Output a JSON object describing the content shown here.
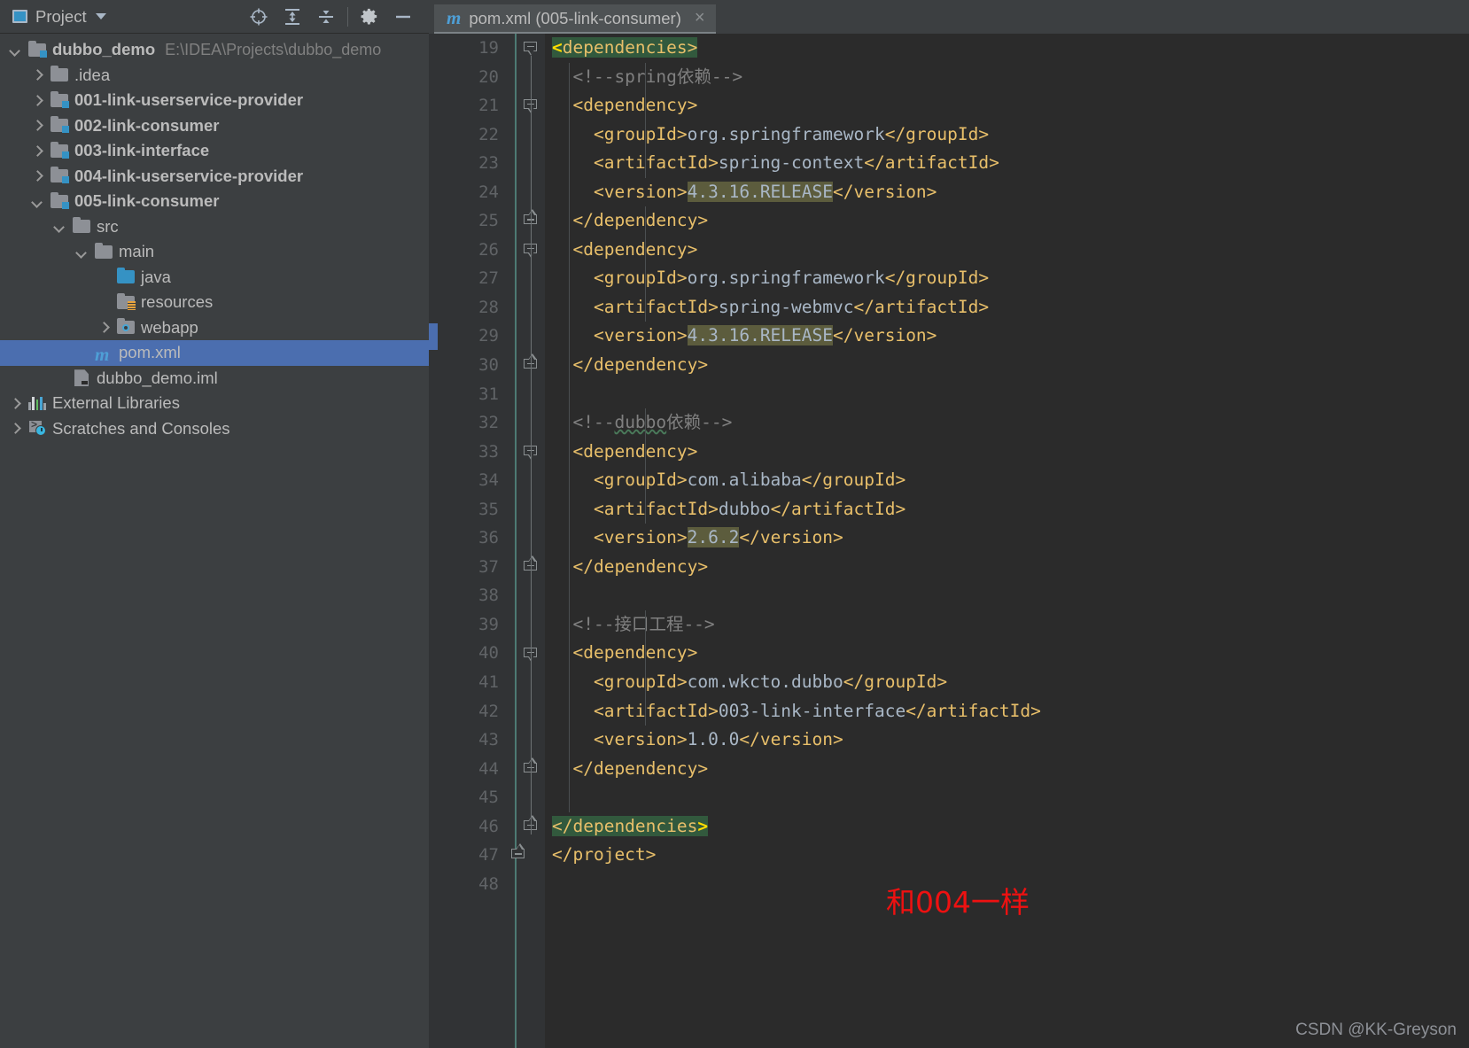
{
  "tool_window": {
    "title": "Project",
    "icons": [
      {
        "name": "project-window-icon"
      },
      {
        "name": "chevron-down-icon"
      },
      {
        "name": "locate-target-icon"
      },
      {
        "name": "expand-all-icon"
      },
      {
        "name": "collapse-all-icon"
      },
      {
        "name": "settings-gear-icon"
      },
      {
        "name": "minimize-icon"
      }
    ]
  },
  "tree": [
    {
      "label": "dubbo_demo",
      "path": "E:\\IDEA\\Projects\\dubbo_demo",
      "indent": 0,
      "arrow": "down",
      "icon": "module-folder",
      "bold": true,
      "selected": false
    },
    {
      "label": ".idea",
      "path": "",
      "indent": 1,
      "arrow": "right",
      "icon": "folder",
      "bold": false,
      "selected": false
    },
    {
      "label": "001-link-userservice-provider",
      "path": "",
      "indent": 1,
      "arrow": "right",
      "icon": "module-folder",
      "bold": true,
      "selected": false
    },
    {
      "label": "002-link-consumer",
      "path": "",
      "indent": 1,
      "arrow": "right",
      "icon": "module-folder",
      "bold": true,
      "selected": false
    },
    {
      "label": "003-link-interface",
      "path": "",
      "indent": 1,
      "arrow": "right",
      "icon": "module-folder",
      "bold": true,
      "selected": false
    },
    {
      "label": "004-link-userservice-provider",
      "path": "",
      "indent": 1,
      "arrow": "right",
      "icon": "module-folder",
      "bold": true,
      "selected": false
    },
    {
      "label": "005-link-consumer",
      "path": "",
      "indent": 1,
      "arrow": "down",
      "icon": "module-folder",
      "bold": true,
      "selected": false
    },
    {
      "label": "src",
      "path": "",
      "indent": 2,
      "arrow": "down",
      "icon": "folder",
      "bold": false,
      "selected": false
    },
    {
      "label": "main",
      "path": "",
      "indent": 3,
      "arrow": "down",
      "icon": "folder",
      "bold": false,
      "selected": false
    },
    {
      "label": "java",
      "path": "",
      "indent": 4,
      "arrow": "none",
      "icon": "source-folder",
      "bold": false,
      "selected": false
    },
    {
      "label": "resources",
      "path": "",
      "indent": 4,
      "arrow": "none",
      "icon": "resources-folder",
      "bold": false,
      "selected": false
    },
    {
      "label": "webapp",
      "path": "",
      "indent": 4,
      "arrow": "right",
      "icon": "webapp-folder",
      "bold": false,
      "selected": false
    },
    {
      "label": "pom.xml",
      "path": "",
      "indent": 3,
      "arrow": "none",
      "icon": "maven-file",
      "bold": false,
      "selected": true
    },
    {
      "label": "dubbo_demo.iml",
      "path": "",
      "indent": 2,
      "arrow": "none",
      "icon": "iml-file",
      "bold": false,
      "selected": false
    },
    {
      "label": "External Libraries",
      "path": "",
      "indent": 0,
      "arrow": "right",
      "icon": "libraries",
      "bold": false,
      "selected": false
    },
    {
      "label": "Scratches and Consoles",
      "path": "",
      "indent": 0,
      "arrow": "right",
      "icon": "scratches",
      "bold": false,
      "selected": false
    }
  ],
  "editor": {
    "tab": {
      "label": "pom.xml (005-link-consumer)",
      "icon": "maven-file-icon",
      "close": "×"
    },
    "first_line_number": 19,
    "lines": [
      {
        "n": 19,
        "fold": "open",
        "segs": [
          {
            "t": "<",
            "c": "brk hl"
          },
          {
            "t": "dependencies>",
            "c": "tag hl"
          }
        ]
      },
      {
        "n": 20,
        "fold": "none",
        "segs": [
          {
            "t": "  ",
            "c": "txt"
          },
          {
            "t": "<!--spring依赖-->",
            "c": "cmt"
          }
        ]
      },
      {
        "n": 21,
        "fold": "open",
        "segs": [
          {
            "t": "  ",
            "c": "txt"
          },
          {
            "t": "<dependency>",
            "c": "tag"
          }
        ]
      },
      {
        "n": 22,
        "fold": "none",
        "segs": [
          {
            "t": "    ",
            "c": "txt"
          },
          {
            "t": "<groupId>",
            "c": "tag"
          },
          {
            "t": "org.springframework",
            "c": "txt"
          },
          {
            "t": "</groupId>",
            "c": "tag"
          }
        ]
      },
      {
        "n": 23,
        "fold": "none",
        "segs": [
          {
            "t": "    ",
            "c": "txt"
          },
          {
            "t": "<artifactId>",
            "c": "tag"
          },
          {
            "t": "spring-context",
            "c": "txt"
          },
          {
            "t": "</artifactId>",
            "c": "tag"
          }
        ]
      },
      {
        "n": 24,
        "fold": "none",
        "segs": [
          {
            "t": "    ",
            "c": "txt"
          },
          {
            "t": "<version>",
            "c": "tag"
          },
          {
            "t": "4.3.16.RELEASE",
            "c": "vhl"
          },
          {
            "t": "</version>",
            "c": "tag"
          }
        ]
      },
      {
        "n": 25,
        "fold": "close",
        "segs": [
          {
            "t": "  ",
            "c": "txt"
          },
          {
            "t": "</dependency>",
            "c": "tag"
          }
        ]
      },
      {
        "n": 26,
        "fold": "open",
        "segs": [
          {
            "t": "  ",
            "c": "txt"
          },
          {
            "t": "<dependency>",
            "c": "tag"
          }
        ]
      },
      {
        "n": 27,
        "fold": "none",
        "segs": [
          {
            "t": "    ",
            "c": "txt"
          },
          {
            "t": "<groupId>",
            "c": "tag"
          },
          {
            "t": "org.springframework",
            "c": "txt"
          },
          {
            "t": "</groupId>",
            "c": "tag"
          }
        ]
      },
      {
        "n": 28,
        "fold": "none",
        "segs": [
          {
            "t": "    ",
            "c": "txt"
          },
          {
            "t": "<artifactId>",
            "c": "tag"
          },
          {
            "t": "spring-webmvc",
            "c": "txt"
          },
          {
            "t": "</artifactId>",
            "c": "tag"
          }
        ]
      },
      {
        "n": 29,
        "fold": "none",
        "marker": true,
        "segs": [
          {
            "t": "    ",
            "c": "txt"
          },
          {
            "t": "<version>",
            "c": "tag"
          },
          {
            "t": "4.3.16.RELEASE",
            "c": "vhl"
          },
          {
            "t": "</version>",
            "c": "tag"
          }
        ]
      },
      {
        "n": 30,
        "fold": "close",
        "segs": [
          {
            "t": "  ",
            "c": "txt"
          },
          {
            "t": "</dependency>",
            "c": "tag"
          }
        ]
      },
      {
        "n": 31,
        "fold": "none",
        "segs": []
      },
      {
        "n": 32,
        "fold": "none",
        "segs": [
          {
            "t": "  ",
            "c": "txt"
          },
          {
            "t": "<!--",
            "c": "cmt"
          },
          {
            "t": "dubbo",
            "c": "cmt squig"
          },
          {
            "t": "依赖-->",
            "c": "cmt"
          }
        ]
      },
      {
        "n": 33,
        "fold": "open",
        "segs": [
          {
            "t": "  ",
            "c": "txt"
          },
          {
            "t": "<dependency>",
            "c": "tag"
          }
        ]
      },
      {
        "n": 34,
        "fold": "none",
        "segs": [
          {
            "t": "    ",
            "c": "txt"
          },
          {
            "t": "<groupId>",
            "c": "tag"
          },
          {
            "t": "com.alibaba",
            "c": "txt"
          },
          {
            "t": "</groupId>",
            "c": "tag"
          }
        ]
      },
      {
        "n": 35,
        "fold": "none",
        "segs": [
          {
            "t": "    ",
            "c": "txt"
          },
          {
            "t": "<artifactId>",
            "c": "tag"
          },
          {
            "t": "dubbo",
            "c": "txt"
          },
          {
            "t": "</artifactId>",
            "c": "tag"
          }
        ]
      },
      {
        "n": 36,
        "fold": "none",
        "segs": [
          {
            "t": "    ",
            "c": "txt"
          },
          {
            "t": "<version>",
            "c": "tag"
          },
          {
            "t": "2.6.2",
            "c": "vhl"
          },
          {
            "t": "</version>",
            "c": "tag"
          }
        ]
      },
      {
        "n": 37,
        "fold": "close",
        "segs": [
          {
            "t": "  ",
            "c": "txt"
          },
          {
            "t": "</dependency>",
            "c": "tag"
          }
        ]
      },
      {
        "n": 38,
        "fold": "none",
        "segs": []
      },
      {
        "n": 39,
        "fold": "none",
        "segs": [
          {
            "t": "  ",
            "c": "txt"
          },
          {
            "t": "<!--接口工程-->",
            "c": "cmt"
          }
        ]
      },
      {
        "n": 40,
        "fold": "open",
        "segs": [
          {
            "t": "  ",
            "c": "txt"
          },
          {
            "t": "<dependency>",
            "c": "tag"
          }
        ]
      },
      {
        "n": 41,
        "fold": "none",
        "segs": [
          {
            "t": "    ",
            "c": "txt"
          },
          {
            "t": "<groupId>",
            "c": "tag"
          },
          {
            "t": "com.wkcto.dubbo",
            "c": "txt"
          },
          {
            "t": "</groupId>",
            "c": "tag"
          }
        ]
      },
      {
        "n": 42,
        "fold": "none",
        "segs": [
          {
            "t": "    ",
            "c": "txt"
          },
          {
            "t": "<artifactId>",
            "c": "tag"
          },
          {
            "t": "003-link-interface",
            "c": "txt"
          },
          {
            "t": "</artifactId>",
            "c": "tag"
          }
        ]
      },
      {
        "n": 43,
        "fold": "none",
        "segs": [
          {
            "t": "    ",
            "c": "txt"
          },
          {
            "t": "<version>",
            "c": "tag"
          },
          {
            "t": "1.0.0",
            "c": "txt"
          },
          {
            "t": "</version>",
            "c": "tag"
          }
        ]
      },
      {
        "n": 44,
        "fold": "close",
        "segs": [
          {
            "t": "  ",
            "c": "txt"
          },
          {
            "t": "</dependency>",
            "c": "tag"
          }
        ]
      },
      {
        "n": 45,
        "fold": "none",
        "segs": []
      },
      {
        "n": 46,
        "fold": "close",
        "segs": [
          {
            "t": "</dependencies",
            "c": "tag hl"
          },
          {
            "t": ">",
            "c": "brk hl"
          }
        ]
      },
      {
        "n": 47,
        "fold": "close-root",
        "segs": [
          {
            "t": "</project>",
            "c": "tag"
          }
        ]
      },
      {
        "n": 48,
        "fold": "none",
        "segs": []
      }
    ]
  },
  "annotation": {
    "text": "和004一样",
    "color": "#ee1111"
  },
  "watermark": {
    "text": "CSDN @KK-Greyson"
  }
}
